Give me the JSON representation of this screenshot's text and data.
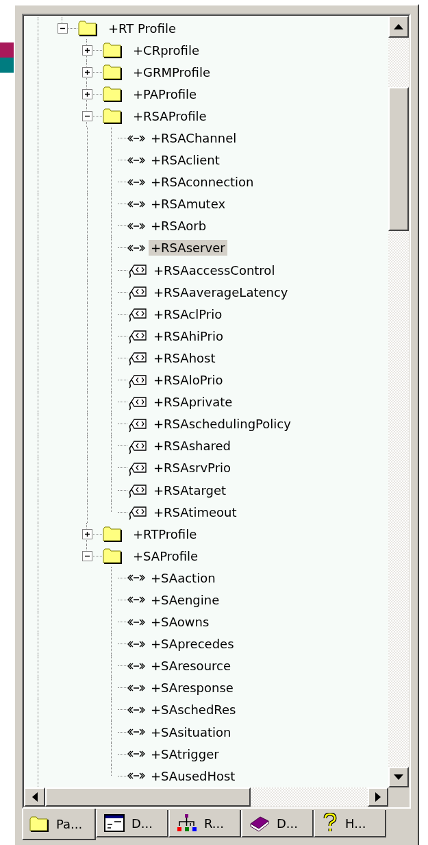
{
  "tree": {
    "nodes": [
      {
        "label": "+RT Profile",
        "kind": "folder",
        "expanded": true,
        "selected": false,
        "children": [
          {
            "label": "+CRprofile",
            "kind": "folder",
            "expanded": false,
            "selected": false
          },
          {
            "label": "+GRMProfile",
            "kind": "folder",
            "expanded": false,
            "selected": false
          },
          {
            "label": "+PAProfile",
            "kind": "folder",
            "expanded": false,
            "selected": false
          },
          {
            "label": "+RSAProfile",
            "kind": "folder",
            "expanded": true,
            "selected": false,
            "children": [
              {
                "label": "+RSAChannel",
                "kind": "association",
                "selected": false
              },
              {
                "label": "+RSAclient",
                "kind": "association",
                "selected": false
              },
              {
                "label": "+RSAconnection",
                "kind": "association",
                "selected": false
              },
              {
                "label": "+RSAmutex",
                "kind": "association",
                "selected": false
              },
              {
                "label": "+RSAorb",
                "kind": "association",
                "selected": false
              },
              {
                "label": "+RSAserver",
                "kind": "association",
                "selected": true
              },
              {
                "label": "+RSAaccessControl",
                "kind": "tag",
                "selected": false
              },
              {
                "label": "+RSAaverageLatency",
                "kind": "tag",
                "selected": false
              },
              {
                "label": "+RSAclPrio",
                "kind": "tag",
                "selected": false
              },
              {
                "label": "+RSAhiPrio",
                "kind": "tag",
                "selected": false
              },
              {
                "label": "+RSAhost",
                "kind": "tag",
                "selected": false
              },
              {
                "label": "+RSAloPrio",
                "kind": "tag",
                "selected": false
              },
              {
                "label": "+RSAprivate",
                "kind": "tag",
                "selected": false
              },
              {
                "label": "+RSAschedulingPolicy",
                "kind": "tag",
                "selected": false
              },
              {
                "label": "+RSAshared",
                "kind": "tag",
                "selected": false
              },
              {
                "label": "+RSAsrvPrio",
                "kind": "tag",
                "selected": false
              },
              {
                "label": "+RSAtarget",
                "kind": "tag",
                "selected": false
              },
              {
                "label": "+RSAtimeout",
                "kind": "tag",
                "selected": false
              }
            ]
          },
          {
            "label": "+RTProfile",
            "kind": "folder",
            "expanded": false,
            "selected": false
          },
          {
            "label": "+SAProfile",
            "kind": "folder",
            "expanded": true,
            "selected": false,
            "children": [
              {
                "label": "+SAaction",
                "kind": "association",
                "selected": false
              },
              {
                "label": "+SAengine",
                "kind": "association",
                "selected": false
              },
              {
                "label": "+SAowns",
                "kind": "association",
                "selected": false
              },
              {
                "label": "+SAprecedes",
                "kind": "association",
                "selected": false
              },
              {
                "label": "+SAresource",
                "kind": "association",
                "selected": false
              },
              {
                "label": "+SAresponse",
                "kind": "association",
                "selected": false
              },
              {
                "label": "+SAschedRes",
                "kind": "association",
                "selected": false
              },
              {
                "label": "+SAsituation",
                "kind": "association",
                "selected": false
              },
              {
                "label": "+SAtrigger",
                "kind": "association",
                "selected": false
              },
              {
                "label": "+SAusedHost",
                "kind": "association",
                "selected": false
              }
            ]
          }
        ]
      }
    ]
  },
  "tabs": [
    {
      "label": "Pa...",
      "kind": "folder",
      "selected": true
    },
    {
      "label": "D...",
      "kind": "window",
      "selected": false
    },
    {
      "label": "R...",
      "kind": "hierarchy",
      "selected": false
    },
    {
      "label": "D...",
      "kind": "book",
      "selected": false
    },
    {
      "label": "H...",
      "kind": "help",
      "selected": false
    }
  ]
}
